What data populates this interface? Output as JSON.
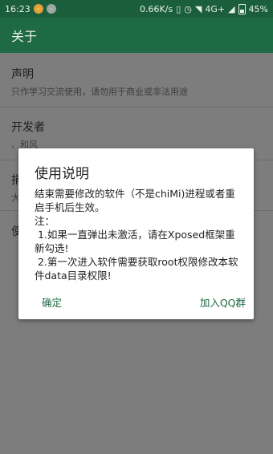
{
  "status_bar": {
    "time": "16:23",
    "net_speed": "0.66K/s",
    "network": "4G+",
    "battery": "45%"
  },
  "toolbar": {
    "title": "关于"
  },
  "prefs": [
    {
      "title": "声明",
      "summary": "只作学习交流使用，请勿用于商业或非法用途"
    },
    {
      "title": "开发者",
      "summary": "、和风"
    },
    {
      "title": "捐",
      "summary": "大"
    },
    {
      "title": "使",
      "summary": ""
    }
  ],
  "dialog": {
    "title": "使用说明",
    "body": "结束需要修改的软件（不是chiMi)进程或者重启手机后生效。\n注：\n 1.如果一直弹出未激活，请在Xposed框架重新勾选!\n 2.第一次进入软件需要获取root权限修改本软件data目录权限!",
    "confirm_label": "确定",
    "join_qq_label": "加入QQ群"
  },
  "colors": {
    "status_bar": "#1b5e3c",
    "toolbar": "#1e6a44",
    "accent": "#1e6a44",
    "scrim_background": "#7d7d7d"
  },
  "icons": [
    "app-notification-icon",
    "notification-icon",
    "vibrate-icon",
    "alarm-icon",
    "wifi-icon",
    "signal-icon",
    "battery-icon"
  ]
}
